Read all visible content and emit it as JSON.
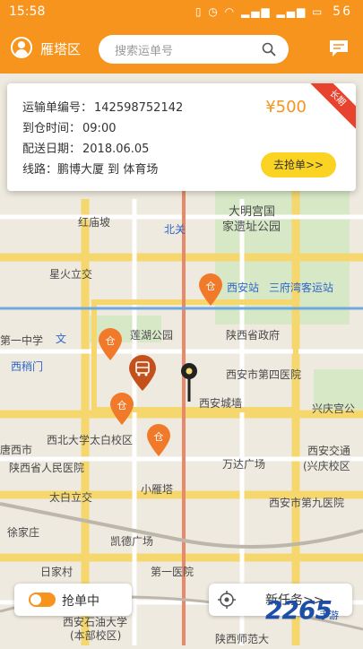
{
  "status": {
    "time": "15:58",
    "battery": "56"
  },
  "header": {
    "district": "雁塔区",
    "search_placeholder": "搜索运单号"
  },
  "card": {
    "order_label": "运输单编号：",
    "order_no": "142598752142",
    "arrive_label": "到仓时间：",
    "arrive_time": "09:00",
    "date_label": "配送日期：",
    "date": "2018.06.05",
    "route_label": "线路：",
    "route_from": "鹏博大厦",
    "route_to_word": "到",
    "route_to": "体育场",
    "price": "¥500",
    "ribbon": "长期",
    "grab_button": "去抢单>>"
  },
  "map": {
    "labels": [
      "大明宫国",
      "家遗址公园",
      "红庙坡",
      "北关",
      "星火立交",
      "西安站",
      "三府湾客运站",
      "莲湖公园",
      "陕西省政府",
      "第一中学",
      "文",
      "西稍门",
      "西安市第四医院",
      "西安城墙",
      "兴庆宫公",
      "西北大学太白校区",
      "唐西市",
      "陕西省人民医院",
      "万达广场",
      "西安交通",
      "(兴庆校区",
      "小雁塔",
      "太白立交",
      "西安市第九医院",
      "徐家庄",
      "凯德广场",
      "第一医院",
      "日家村",
      "西安石油大学",
      "(本部校区)",
      "陕西师范大"
    ]
  },
  "bottom": {
    "toggle_label": "抢单中",
    "new_task_label": "新任务>>"
  },
  "watermark": {
    "main": "2265",
    "sub": "手游"
  },
  "colors": {
    "brand_orange": "#f7941d",
    "button_yellow": "#fbd322",
    "ribbon_red": "#e8432e"
  }
}
